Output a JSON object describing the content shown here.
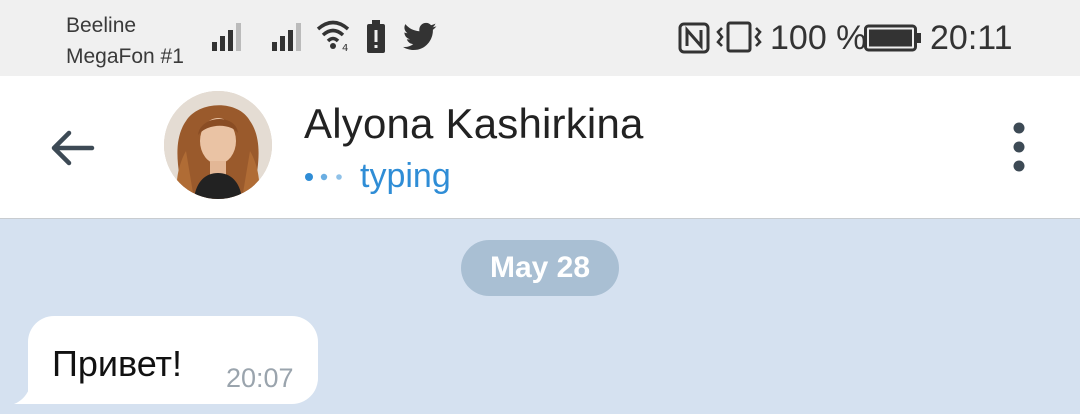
{
  "status_bar": {
    "carrier_1": "Beeline",
    "carrier_2": "MegaFon #1",
    "battery_percent": "100 %",
    "time": "20:11",
    "icons": [
      "signal-icon",
      "signal-icon",
      "wifi-icon",
      "battery-saver-icon",
      "twitter-icon",
      "nfc-icon",
      "vibrate-icon",
      "battery-icon"
    ]
  },
  "header": {
    "contact_name": "Alyona Kashirkina",
    "status": "typing",
    "status_color": "#2f8dd6",
    "back_icon": "arrow-left-icon",
    "menu_icon": "more-vertical-icon"
  },
  "chat": {
    "date_separator": "May 28",
    "messages": [
      {
        "text": "Привет!",
        "time": "20:07",
        "direction": "incoming"
      }
    ]
  },
  "colors": {
    "chat_background": "#d5e1f0",
    "date_pill": "#a9bfd3",
    "bubble": "#ffffff"
  }
}
